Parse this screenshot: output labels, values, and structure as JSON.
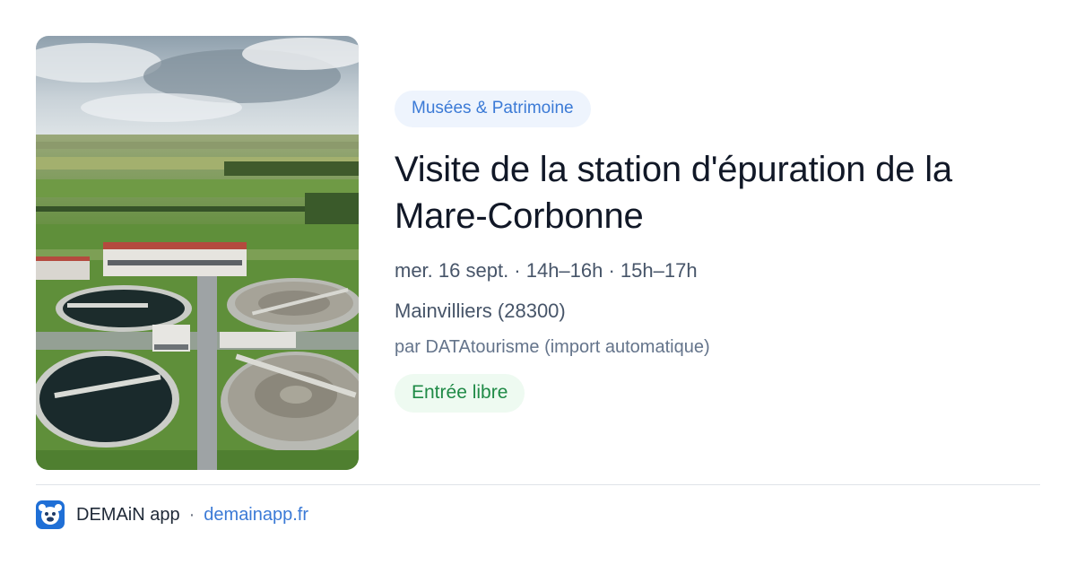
{
  "card": {
    "image_alt": "Vue aérienne de la station d'épuration",
    "category": "Musées & Patrimoine",
    "title": "Visite de la station d'épuration de la Mare-Corbonne",
    "date": "mer. 16 sept. · 14h–16h · 15h–17h",
    "location": "Mainvilliers (28300)",
    "source": "par DATAtourisme (import automatique)",
    "price": "Entrée libre"
  },
  "footer": {
    "app_name": "DEMAiN app",
    "separator": "·",
    "url": "demainapp.fr"
  },
  "colors": {
    "accent": "#3b7ad6",
    "category_bg": "#eef4fd",
    "price_text": "#1f8a46",
    "price_bg": "#eefaf1"
  }
}
